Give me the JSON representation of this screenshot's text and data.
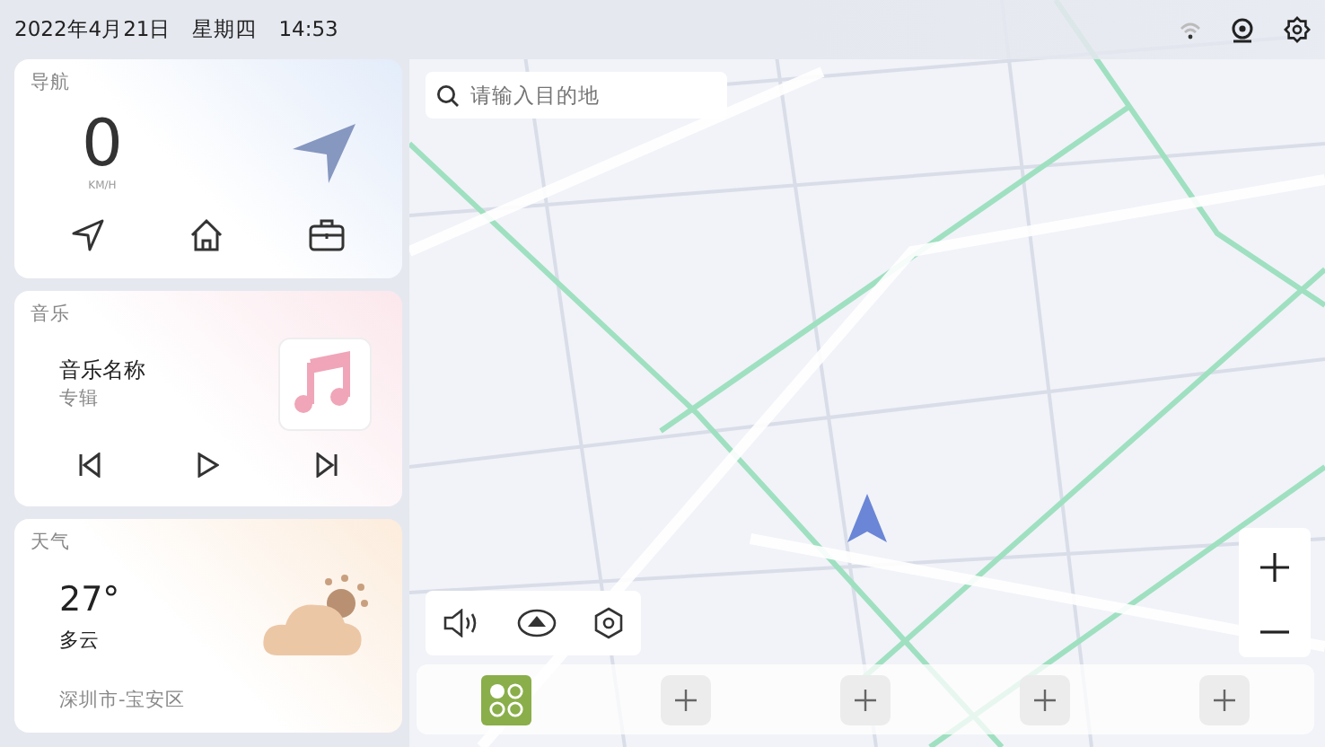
{
  "status_bar": {
    "date": "2022年4月21日",
    "weekday": "星期四",
    "time": "14:53"
  },
  "navigation": {
    "title": "导航",
    "speed": "0",
    "unit": "KM/H"
  },
  "music": {
    "title": "音乐",
    "song": "音乐名称",
    "album": "专辑"
  },
  "weather": {
    "title": "天气",
    "temperature": "27°",
    "condition": "多云",
    "location": "深圳市-宝安区"
  },
  "search": {
    "placeholder": "请输入目的地"
  }
}
